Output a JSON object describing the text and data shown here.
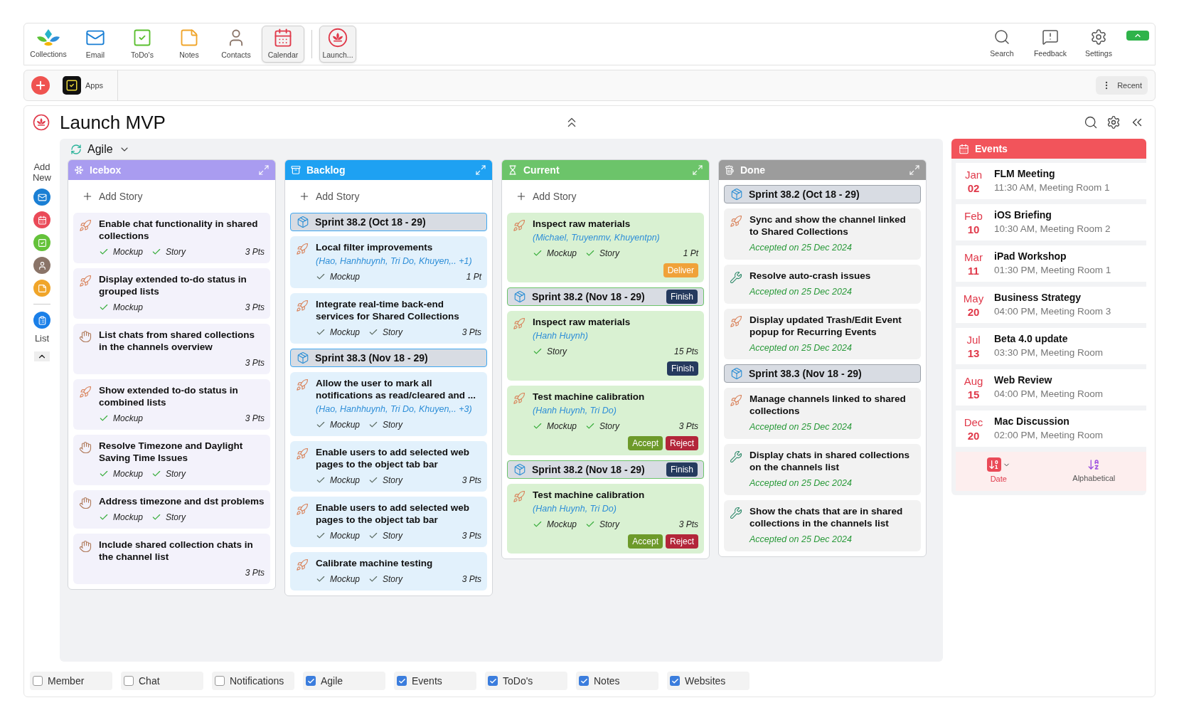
{
  "app_bar": {
    "items": [
      {
        "kind": "collections",
        "label": "Collections",
        "selected": false
      },
      {
        "kind": "email",
        "label": "Email",
        "selected": false
      },
      {
        "kind": "todos",
        "label": "ToDo's",
        "selected": false
      },
      {
        "kind": "notes",
        "label": "Notes",
        "selected": false
      },
      {
        "kind": "contacts",
        "label": "Contacts",
        "selected": false
      },
      {
        "kind": "calendar",
        "label": "Calendar",
        "selected": true
      }
    ],
    "pinned": [
      {
        "kind": "launch",
        "label": "Launch...",
        "selected": true
      }
    ],
    "tools": [
      {
        "kind": "search",
        "label": "Search"
      },
      {
        "kind": "feedback",
        "label": "Feedback"
      },
      {
        "kind": "settings",
        "label": "Settings"
      }
    ]
  },
  "toolbar": {
    "apps": "Apps",
    "recent": "Recent"
  },
  "page": {
    "title": "Launch MVP",
    "view": "Agile"
  },
  "sidebar": {
    "add_label": "Add New",
    "items": [
      {
        "kind": "email"
      },
      {
        "kind": "calendar"
      },
      {
        "kind": "todos"
      },
      {
        "kind": "contacts"
      },
      {
        "kind": "notes"
      }
    ],
    "list_label": "List"
  },
  "columns": [
    {
      "kind": "icebox",
      "title": "Icebox",
      "add_story": "Add Story",
      "entries": [
        {
          "kind": "rocket",
          "title": "Enable chat functionality in shared collections",
          "tags": [
            "Mockup",
            "Story"
          ],
          "points": "3 Pts"
        },
        {
          "kind": "rocket",
          "title": "Display extended to-do status in grouped lists",
          "tags": [
            "Mockup"
          ],
          "points": "3 Pts"
        },
        {
          "kind": "hand",
          "title": "List chats from shared collections in the channels overview",
          "points": "3 Pts"
        },
        {
          "kind": "rocket",
          "title": "Show extended to-do status in combined lists",
          "tags": [
            "Mockup"
          ],
          "points": "3 Pts"
        },
        {
          "kind": "hand",
          "title": "Resolve Timezone and Daylight Saving Time Issues",
          "tags": [
            "Mockup",
            "Story"
          ]
        },
        {
          "kind": "hand",
          "title": "Address timezone and dst problems",
          "tags": [
            "Mockup",
            "Story"
          ]
        },
        {
          "kind": "hand",
          "title": "Include shared collection chats in the channel list",
          "points": "3 Pts"
        }
      ]
    },
    {
      "kind": "backlog",
      "title": "Backlog",
      "add_story": "Add Story",
      "entries": [
        {
          "kind": "sprint",
          "title": "Sprint 38.2 (Oct 18 - 29)"
        },
        {
          "kind": "rocket",
          "title": "Local filter improvements",
          "assignees": "(Hao, Hanhhuynh, Tri Do, Khuyen,.. +1)",
          "tags": [
            "Mockup"
          ],
          "points": "1 Pt"
        },
        {
          "kind": "rocket",
          "title": "Integrate real-time back-end services for Shared Collections",
          "tags": [
            "Mockup",
            "Story"
          ],
          "points": "3 Pts"
        },
        {
          "kind": "sprint",
          "title": "Sprint 38.3 (Nov 18 - 29)"
        },
        {
          "kind": "rocket",
          "title": "Allow the user to mark all notifications as read/cleared and ...",
          "assignees": "(Hao, Hanhhuynh, Tri Do, Khuyen,.. +3)",
          "tags": [
            "Mockup",
            "Story"
          ]
        },
        {
          "kind": "rocket",
          "title": "Enable users to add selected web pages to the object tab bar",
          "tags": [
            "Mockup",
            "Story"
          ],
          "points": "3 Pts"
        },
        {
          "kind": "rocket",
          "title": "Enable users to add selected web pages to the object tab bar",
          "tags": [
            "Mockup",
            "Story"
          ],
          "points": "3 Pts"
        },
        {
          "kind": "rocket",
          "title": "Calibrate machine testing",
          "tags": [
            "Mockup",
            "Story"
          ],
          "points": "3 Pts"
        }
      ]
    },
    {
      "kind": "current",
      "title": "Current",
      "add_story": "Add Story",
      "entries": [
        {
          "kind": "rocket",
          "title": "Inspect raw materials",
          "assignees": "(Michael, Truyenmv, Khuyentpn)",
          "tags": [
            "Mockup",
            "Story"
          ],
          "points": "1 Pt",
          "actions": [
            {
              "kind": "deliver",
              "label": "Deliver"
            }
          ]
        },
        {
          "kind": "sprint",
          "title": "Sprint 38.2 (Nov 18 - 29)",
          "action": "Finish"
        },
        {
          "kind": "rocket",
          "title": "Inspect raw materials",
          "assignees": "(Hanh Huynh)",
          "tags": [
            "Story"
          ],
          "points": "15 Pts",
          "actions": [
            {
              "kind": "finish",
              "label": "Finish"
            }
          ]
        },
        {
          "kind": "rocket",
          "title": "Test machine calibration",
          "assignees": "(Hanh Huynh, Tri Do)",
          "tags": [
            "Mockup",
            "Story"
          ],
          "points": "3 Pts",
          "actions": [
            {
              "kind": "accept",
              "label": "Accept"
            },
            {
              "kind": "reject",
              "label": "Reject"
            }
          ]
        },
        {
          "kind": "sprint",
          "title": "Sprint 38.2 (Nov 18 - 29)",
          "action": "Finish"
        },
        {
          "kind": "rocket",
          "title": "Test machine calibration",
          "assignees": "(Hanh Huynh, Tri Do)",
          "tags": [
            "Mockup",
            "Story"
          ],
          "points": "3 Pts",
          "actions": [
            {
              "kind": "accept",
              "label": "Accept"
            },
            {
              "kind": "reject",
              "label": "Reject"
            }
          ]
        }
      ]
    },
    {
      "kind": "done",
      "title": "Done",
      "entries": [
        {
          "kind": "sprint",
          "title": "Sprint 38.2 (Oct 18 - 29)"
        },
        {
          "kind": "rocket",
          "title": "Sync and show the channel linked to Shared Collections",
          "accepted": "Accepted on 25 Dec 2024"
        },
        {
          "kind": "wrench",
          "title": "Resolve auto-crash issues",
          "accepted": "Accepted on 25 Dec 2024"
        },
        {
          "kind": "rocket",
          "title": "Display updated Trash/Edit Event popup for Recurring Events",
          "accepted": "Accepted on 25 Dec 2024"
        },
        {
          "kind": "sprint",
          "title": "Sprint 38.3 (Nov 18 - 29)"
        },
        {
          "kind": "rocket",
          "title": "Manage channels linked to shared collections",
          "accepted": "Accepted on 25 Dec 2024"
        },
        {
          "kind": "wrench",
          "title": "Display chats in shared collections on the channels list",
          "accepted": "Accepted on 25 Dec 2024"
        },
        {
          "kind": "wrench",
          "title": "Show the chats that are in shared collections in the channels list",
          "accepted": "Accepted on 25 Dec 2024"
        }
      ]
    }
  ],
  "events": {
    "title": "Events",
    "items": [
      {
        "month": "Jan",
        "day": "02",
        "title": "FLM Meeting",
        "detail": "11:30 AM, Meeting Room 1"
      },
      {
        "month": "Feb",
        "day": "10",
        "title": "iOS Briefing",
        "detail": "10:30 AM, Meeting Room 2"
      },
      {
        "month": "Mar",
        "day": "11",
        "title": "iPad Workshop",
        "detail": "01:30 PM, Meeting Room 1"
      },
      {
        "month": "May",
        "day": "20",
        "title": "Business Strategy",
        "detail": "04:00 PM, Meeting Room 3"
      },
      {
        "month": "Jul",
        "day": "13",
        "title": "Beta 4.0 update",
        "detail": "03:30 PM, Meeting Room"
      },
      {
        "month": "Aug",
        "day": "15",
        "title": "Web Review",
        "detail": "04:00 PM, Meeting Room"
      },
      {
        "month": "Dec",
        "day": "20",
        "title": "Mac Discussion",
        "detail": "02:00 PM, Meeting Room"
      }
    ],
    "sort": [
      {
        "kind": "date",
        "label": "Date",
        "selected": true
      },
      {
        "kind": "alpha",
        "label": "Alphabetical",
        "selected": false
      }
    ]
  },
  "filters": [
    {
      "label": "Member",
      "checked": false
    },
    {
      "label": "Chat",
      "checked": false
    },
    {
      "label": "Notifications",
      "checked": false
    },
    {
      "label": "Agile",
      "checked": true
    },
    {
      "label": "Events",
      "checked": true
    },
    {
      "label": "ToDo's",
      "checked": true
    },
    {
      "label": "Notes",
      "checked": true
    },
    {
      "label": "Websites",
      "checked": true
    }
  ]
}
